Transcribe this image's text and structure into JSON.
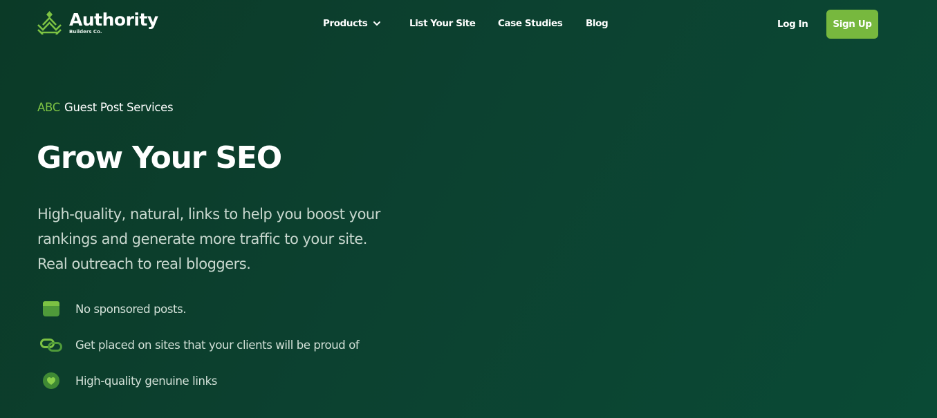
{
  "brand": {
    "name": "Authority",
    "tagline": "Builders Co.",
    "accent_color": "#7cc243"
  },
  "nav": {
    "items": [
      {
        "label": "Products",
        "has_dropdown": true
      },
      {
        "label": "List Your Site"
      },
      {
        "label": "Case Studies"
      },
      {
        "label": "Blog"
      }
    ],
    "login_label": "Log In",
    "signup_label": "Sign Up",
    "signup_color": "#77b83e"
  },
  "hero": {
    "eyebrow_accent": "ABC",
    "eyebrow_text": "Guest Post Services",
    "title": "Grow Your SEO",
    "description_lines": [
      "High-quality, natural, links to help you boost your",
      "rankings and generate more traffic to your site.",
      "Real outreach to real bloggers."
    ]
  },
  "features": [
    {
      "icon": "browser-window-icon",
      "label": "No sponsored posts."
    },
    {
      "icon": "link-chain-icon",
      "label": "Get placed on sites that your clients will be proud of"
    },
    {
      "icon": "heart-icon",
      "label": "High-quality genuine links"
    }
  ],
  "colors": {
    "background": "#0c4130",
    "text_primary": "#ffffff",
    "text_muted": "#c9d8cf"
  }
}
